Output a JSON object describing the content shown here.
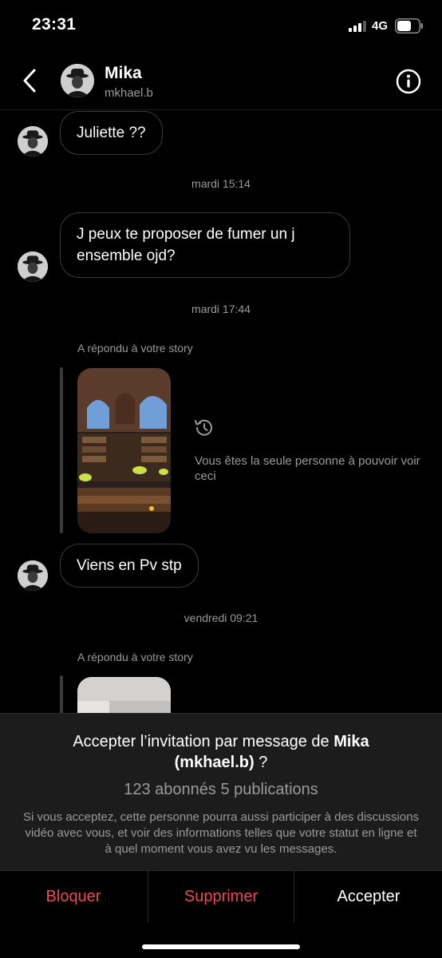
{
  "status_bar": {
    "time": "23:31",
    "network": "4G"
  },
  "header": {
    "name": "Mika",
    "username": "mkhael.b",
    "back_icon": "chevron-left-icon",
    "info_icon": "info-icon"
  },
  "messages": [
    {
      "type": "bubble",
      "text": "Juliette ??"
    },
    {
      "type": "timestamp",
      "text": "mardi 15:14"
    },
    {
      "type": "bubble",
      "lines": [
        "J peux te proposer de fumer un j",
        "ensemble ojd?"
      ]
    },
    {
      "type": "timestamp",
      "text": "mardi 17:44"
    },
    {
      "type": "story_reply",
      "note": "A répondu à votre story",
      "visibility_text": "Vous êtes la seule personne à pouvoir voir ceci"
    },
    {
      "type": "bubble",
      "text": "Viens en Pv stp"
    },
    {
      "type": "timestamp",
      "text": "vendredi 09:21"
    },
    {
      "type": "story_reply",
      "note": "A répondu à votre story"
    }
  ],
  "invite": {
    "title_prefix": "Accepter l’invitation par message de ",
    "name": "Mika",
    "username_paren": "(mkhael.b)",
    "title_suffix": " ?",
    "stats": "123 abonnés 5 publications",
    "description": "Si vous acceptez, cette personne pourra aussi participer à des discussions vidéo avec vous, et voir des informations telles que votre statut en ligne et à quel moment vous avez vu les messages."
  },
  "actions": {
    "block": "Bloquer",
    "delete": "Supprimer",
    "accept": "Accepter"
  },
  "colors": {
    "background": "#000000",
    "danger": "#ed4956",
    "muted_text": "#9a9a9a",
    "panel": "#1c1c1c"
  }
}
